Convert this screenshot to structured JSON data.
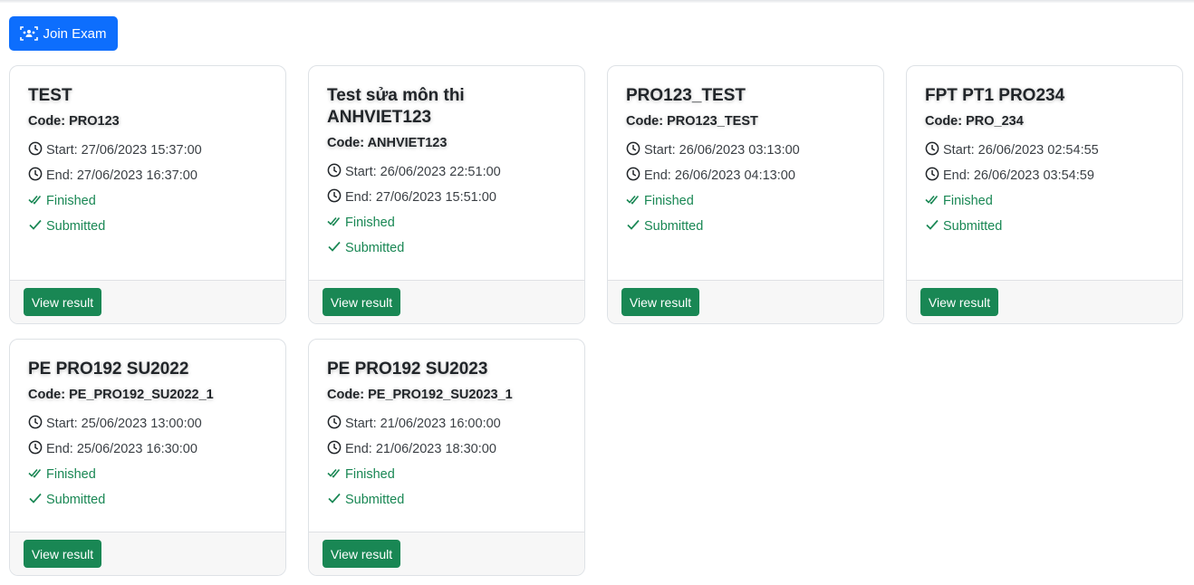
{
  "toolbar": {
    "join_label": "Join Exam",
    "join_icon": "people-group-icon",
    "accent_color": "#0d6efd"
  },
  "colors": {
    "success": "#198754",
    "card_border": "#dee2e6",
    "footer_bg": "#f7f7f7"
  },
  "exams": [
    {
      "title": "TEST",
      "code": "Code: PRO123",
      "start": "Start: 27/06/2023 15:37:00",
      "end": "End: 27/06/2023 16:37:00",
      "status": "Finished",
      "submission": "Submitted",
      "action": "View result"
    },
    {
      "title": "Test sửa môn thi ANHVIET123",
      "code": "Code: ANHVIET123",
      "start": "Start: 26/06/2023 22:51:00",
      "end": "End: 27/06/2023 15:51:00",
      "status": "Finished",
      "submission": "Submitted",
      "action": "View result"
    },
    {
      "title": "PRO123_TEST",
      "code": "Code: PRO123_TEST",
      "start": "Start: 26/06/2023 03:13:00",
      "end": "End: 26/06/2023 04:13:00",
      "status": "Finished",
      "submission": "Submitted",
      "action": "View result"
    },
    {
      "title": "FPT PT1 PRO234",
      "code": "Code: PRO_234",
      "start": "Start: 26/06/2023 02:54:55",
      "end": "End: 26/06/2023 03:54:59",
      "status": "Finished",
      "submission": "Submitted",
      "action": "View result"
    },
    {
      "title": "PE PRO192 SU2022",
      "code": "Code: PE_PRO192_SU2022_1",
      "start": "Start: 25/06/2023 13:00:00",
      "end": "End: 25/06/2023 16:30:00",
      "status": "Finished",
      "submission": "Submitted",
      "action": "View result"
    },
    {
      "title": "PE PRO192 SU2023",
      "code": "Code: PE_PRO192_SU2023_1",
      "start": "Start: 21/06/2023 16:00:00",
      "end": "End: 21/06/2023 18:30:00",
      "status": "Finished",
      "submission": "Submitted",
      "action": "View result"
    }
  ]
}
